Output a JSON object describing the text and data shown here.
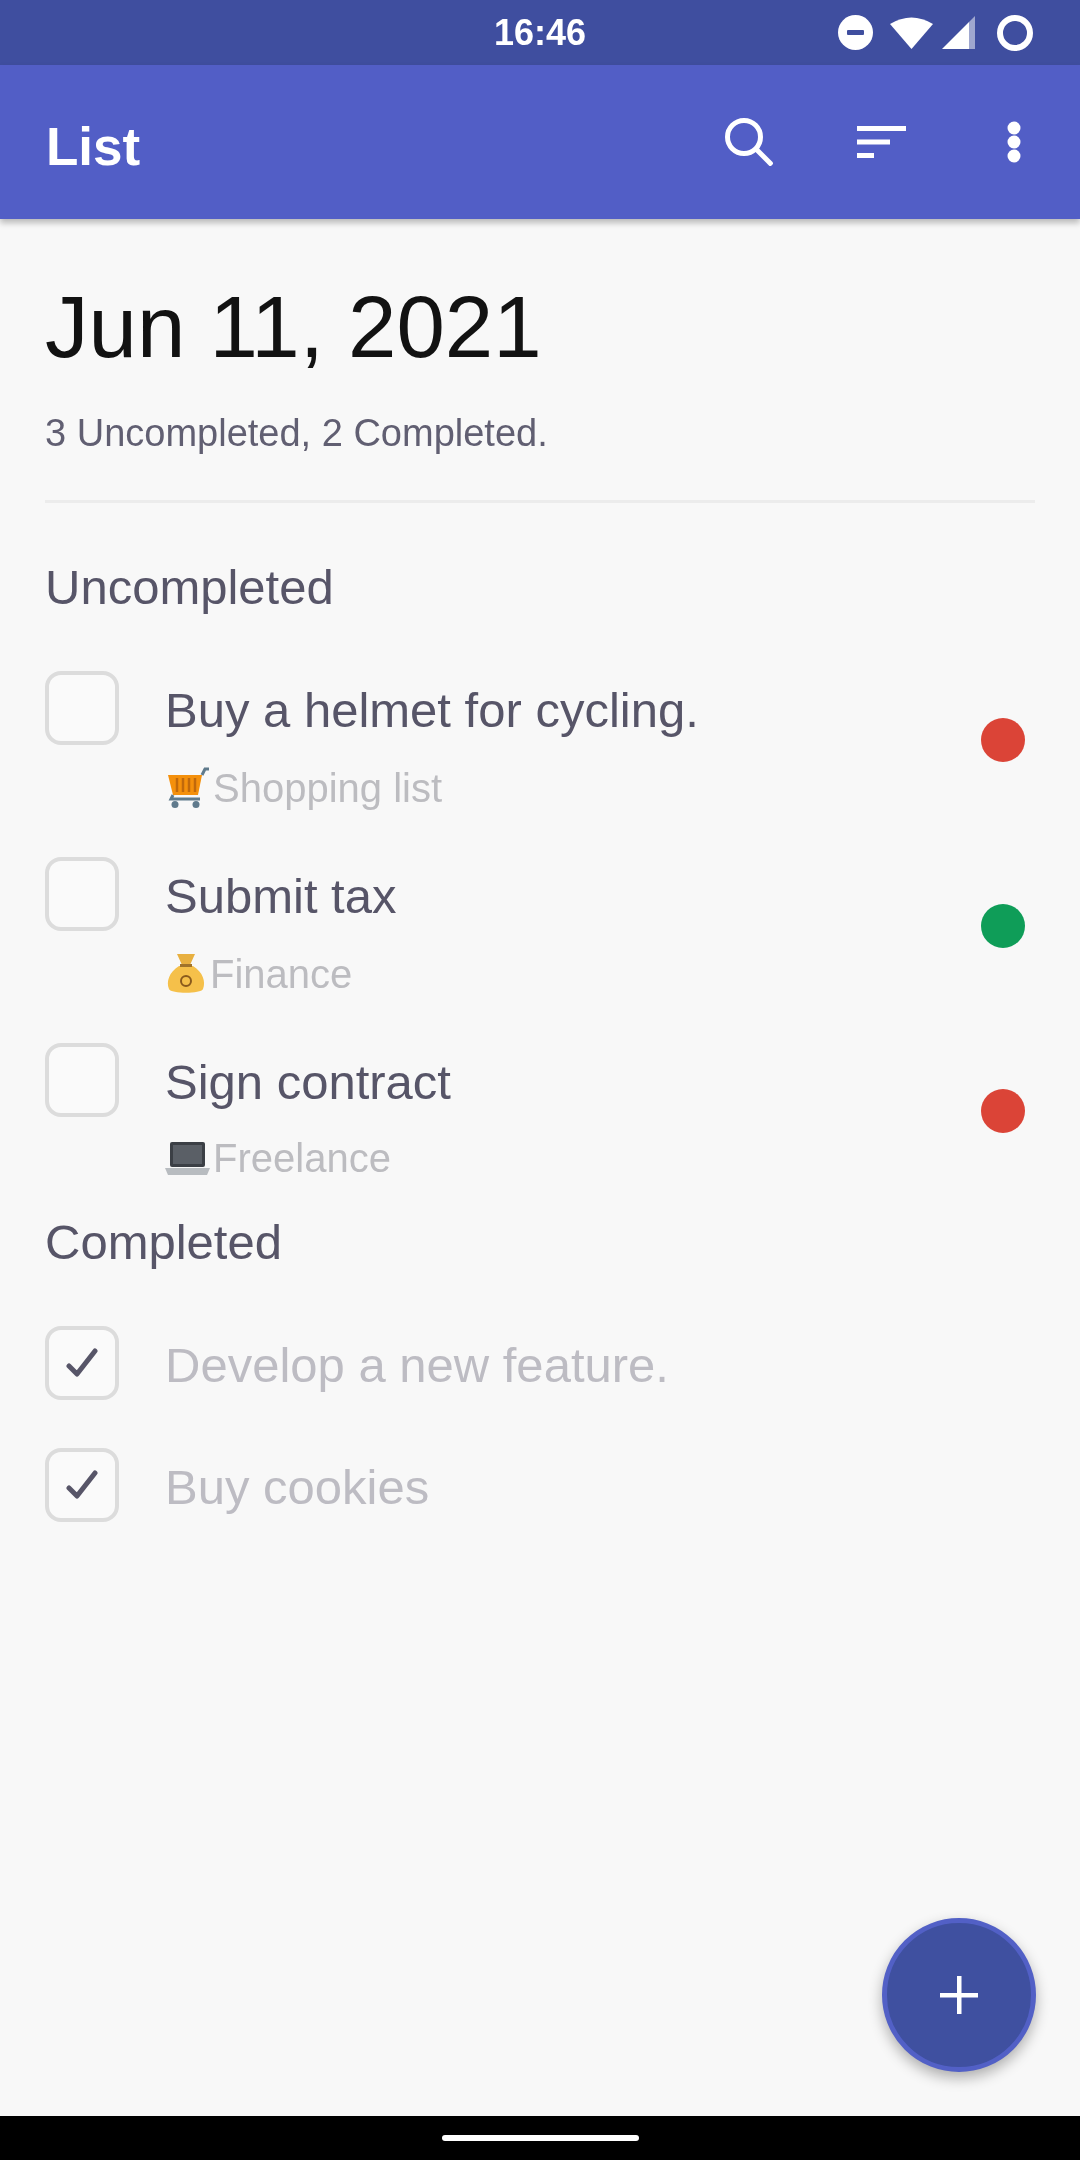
{
  "status_bar": {
    "time": "16:46"
  },
  "app_bar": {
    "title": "List"
  },
  "header": {
    "date": "Jun 11, 2021",
    "summary": "3 Uncompleted, 2 Completed."
  },
  "sections": [
    {
      "title": "Uncompleted",
      "tasks": [
        {
          "title": "Buy a helmet for cycling.",
          "checked": false,
          "category": {
            "kind": "cart",
            "label": "Shopping list"
          },
          "color": "#db4437"
        },
        {
          "title": "Submit tax",
          "checked": false,
          "category": {
            "kind": "moneybag",
            "label": "Finance"
          },
          "color": "#0f9d58"
        },
        {
          "title": "Sign contract",
          "checked": false,
          "category": {
            "kind": "laptop",
            "label": "Freelance"
          },
          "color": "#db4437"
        }
      ]
    },
    {
      "title": "Completed",
      "tasks": [
        {
          "title": "Develop a new feature.",
          "checked": true
        },
        {
          "title": "Buy cookies",
          "checked": true
        }
      ]
    }
  ]
}
